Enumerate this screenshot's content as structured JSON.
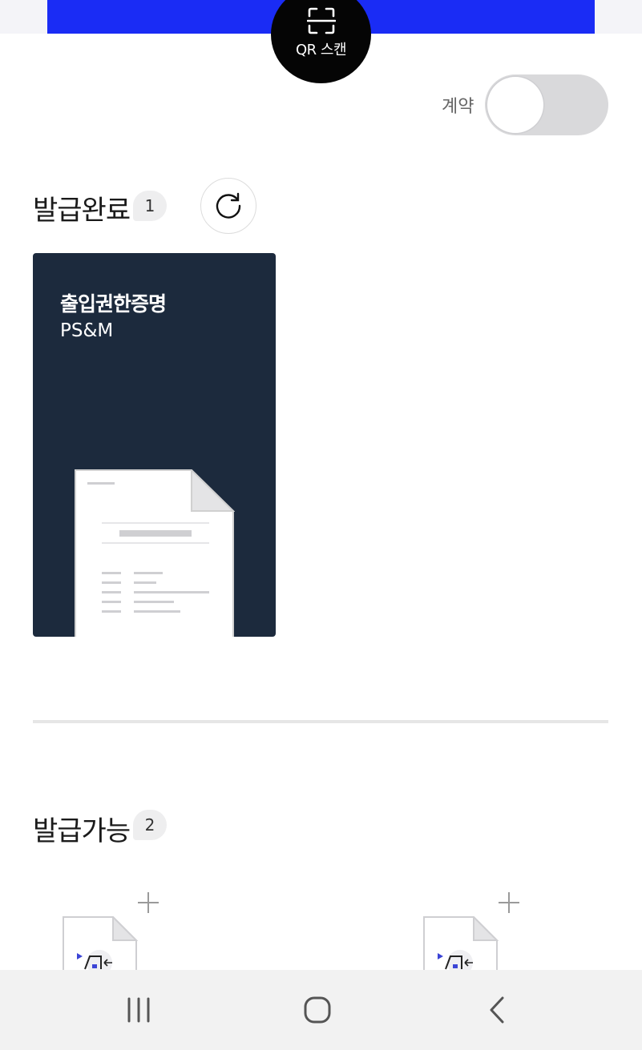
{
  "header": {
    "qr_button_label": "QR 스캔",
    "qr_icon": "qr-scan-icon",
    "accent_color": "#1a2cf5"
  },
  "contract_toggle": {
    "label": "계약",
    "enabled": false
  },
  "issued": {
    "title": "발급완료",
    "count": "1",
    "refresh_icon": "refresh-icon",
    "cards": [
      {
        "title": "출입권한증명",
        "issuer": "PS&M",
        "background": "#1c2a3d"
      }
    ]
  },
  "available": {
    "title": "발급가능",
    "count": "2"
  },
  "navbar": {
    "recent_icon": "recent-apps-icon",
    "home_icon": "home-icon",
    "back_icon": "back-icon"
  }
}
